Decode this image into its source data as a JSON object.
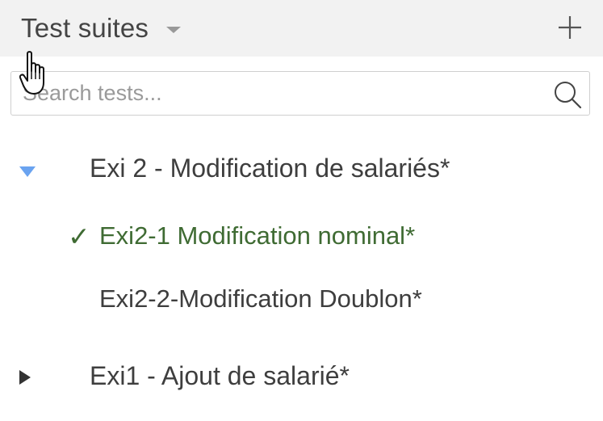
{
  "header": {
    "title": "Test suites",
    "dropdown_icon": "chevron-down-icon",
    "add_icon": "plus-icon"
  },
  "search": {
    "placeholder": "Search tests...",
    "value": "",
    "icon": "search-icon"
  },
  "tree": {
    "suites": [
      {
        "label": "Exi 2 - Modification de salariés*",
        "expanded": true,
        "toggle_color": "#6aa3f0",
        "tests": [
          {
            "label": "Exi2-1 Modification nominal*",
            "status": "passed",
            "status_icon": "✓",
            "color": "#3f6b33"
          },
          {
            "label": "Exi2-2-Modification Doublon*",
            "status": "none"
          }
        ]
      },
      {
        "label": "Exi1 - Ajout de salarié*",
        "expanded": false
      }
    ]
  },
  "colors": {
    "header_bg": "#f2f2f2",
    "passed_green": "#3f6b33",
    "expand_blue": "#6aa3f0"
  }
}
